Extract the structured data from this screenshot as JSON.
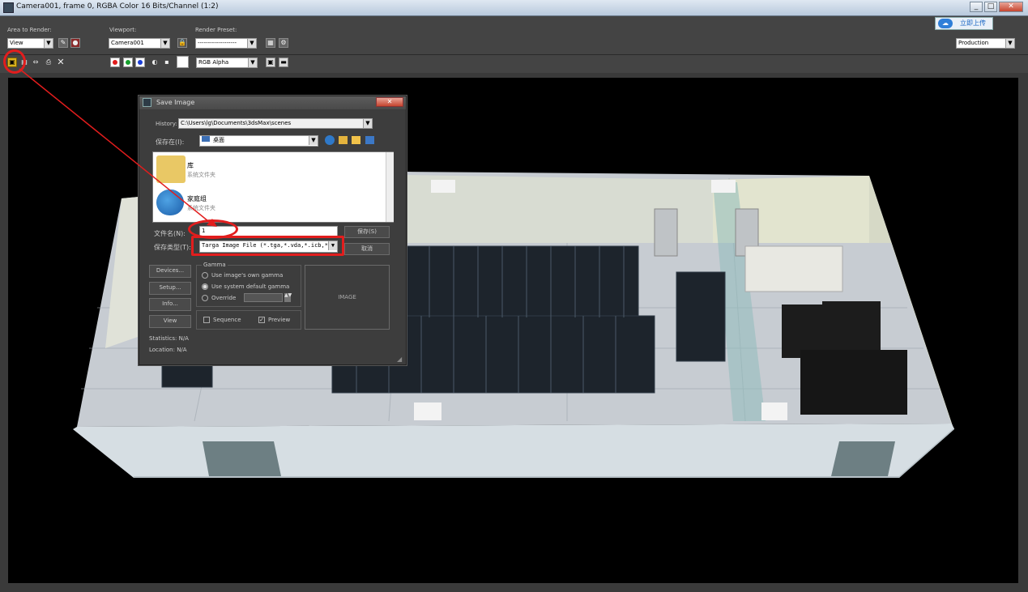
{
  "window": {
    "title": "Camera001, frame 0, RGBA Color 16 Bits/Channel (1:2)",
    "minimize": "_",
    "maximize": "□",
    "close": "✕"
  },
  "upload_button": {
    "label": "立即上传",
    "icon": "cloud-icon"
  },
  "toolbar": {
    "area_label": "Area to Render:",
    "area_value": "View",
    "viewport_label": "Viewport:",
    "viewport_value": "Camera001",
    "preset_label": "Render Preset:",
    "preset_value": "-------------------",
    "production_value": "Production",
    "channel_value": "RGB Alpha",
    "channel_colors": [
      "#e11b1b",
      "#16a02d",
      "#1b3fd6"
    ]
  },
  "dialog": {
    "title": "Save Image",
    "close": "✕",
    "history_label": "History:",
    "history_value": "C:\\Users\\lg\\Documents\\3dsMax\\scenes",
    "save_in_label": "保存在(I):",
    "save_in_value": "桌面",
    "files": [
      {
        "name": "库",
        "type": "系统文件夹",
        "icon": "library-folder-icon"
      },
      {
        "name": "家庭组",
        "type": "系统文件夹",
        "icon": "homegroup-icon"
      }
    ],
    "filename_label": "文件名(N):",
    "filename_value": "1",
    "filetype_label": "保存类型(T):",
    "filetype_value": "Targa Image File (*.tga,*.vda,*.icb,*",
    "save_button": "保存(S)",
    "cancel_button": "取消",
    "devices_button": "Devices...",
    "setup_button": "Setup...",
    "info_button": "Info...",
    "view_button": "View",
    "gamma_group": "Gamma",
    "gamma_image": "Use image's own gamma",
    "gamma_system": "Use system default gamma",
    "gamma_override": "Override",
    "sequence_label": "Sequence",
    "preview_label": "Preview",
    "image_placeholder": "IMAGE",
    "statistics": "Statistics: N/A",
    "location": "Location: N/A"
  }
}
